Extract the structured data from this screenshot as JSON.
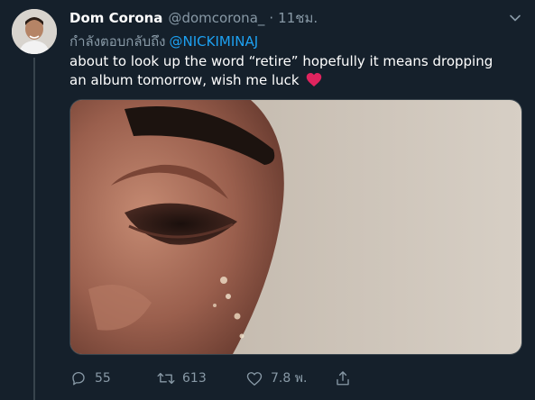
{
  "tweet": {
    "display_name": "Dom Corona",
    "handle": "@domcorona_",
    "separator": "·",
    "time": "11ชม.",
    "reply_prefix": "กำลังตอบกลับถึง",
    "reply_to": "@NICKIMINAJ",
    "text": "about to look up the word “retire” hopefully it means dropping an album tomorrow, wish me luck",
    "emoji_icon": "red-heart-icon"
  },
  "actions": {
    "reply_count": "55",
    "retweet_count": "613",
    "like_count": "7.8 พ.",
    "reply_icon": "reply-icon",
    "retweet_icon": "retweet-icon",
    "like_icon": "heart-outline-icon",
    "share_icon": "share-icon"
  },
  "colors": {
    "background": "#15202b",
    "secondary_text": "#8899a6",
    "link": "#1da1f2",
    "heart": "#e0245e"
  }
}
